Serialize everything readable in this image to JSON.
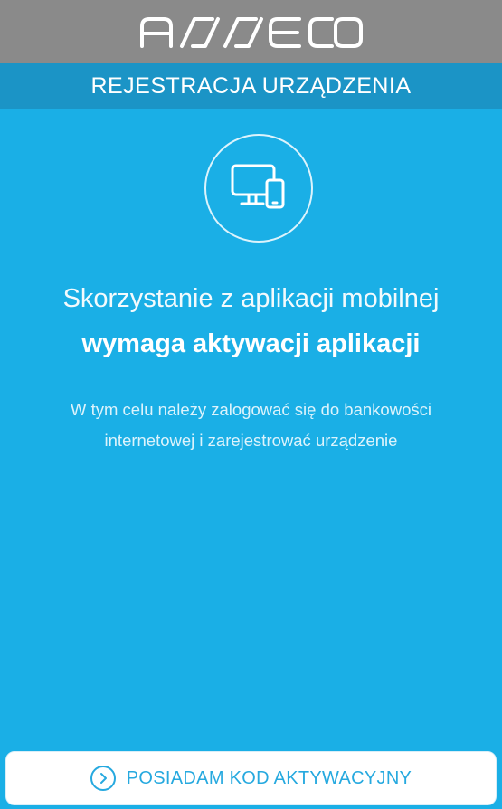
{
  "header": {
    "logo_text": "asseco",
    "subtitle": "REJESTRACJA URZĄDZENIA"
  },
  "main": {
    "icon": "desktop-and-phone-icon",
    "headline_light": "Skorzystanie z aplikacji mobilnej",
    "headline_bold": "wymaga aktywacji aplikacji",
    "description_line1": "W tym celu należy zalogować się do bankowości",
    "description_line2": "internetowej i zarejestrować urządzenie"
  },
  "footer": {
    "button_label": "POSIADAM KOD AKTYWACYJNY",
    "button_icon": "chevron-right-circle-icon"
  },
  "colors": {
    "background": "#1aafe6",
    "topbar": "#8a8a8a",
    "subheader": "#1b94c6",
    "button_text": "#26a9df"
  }
}
